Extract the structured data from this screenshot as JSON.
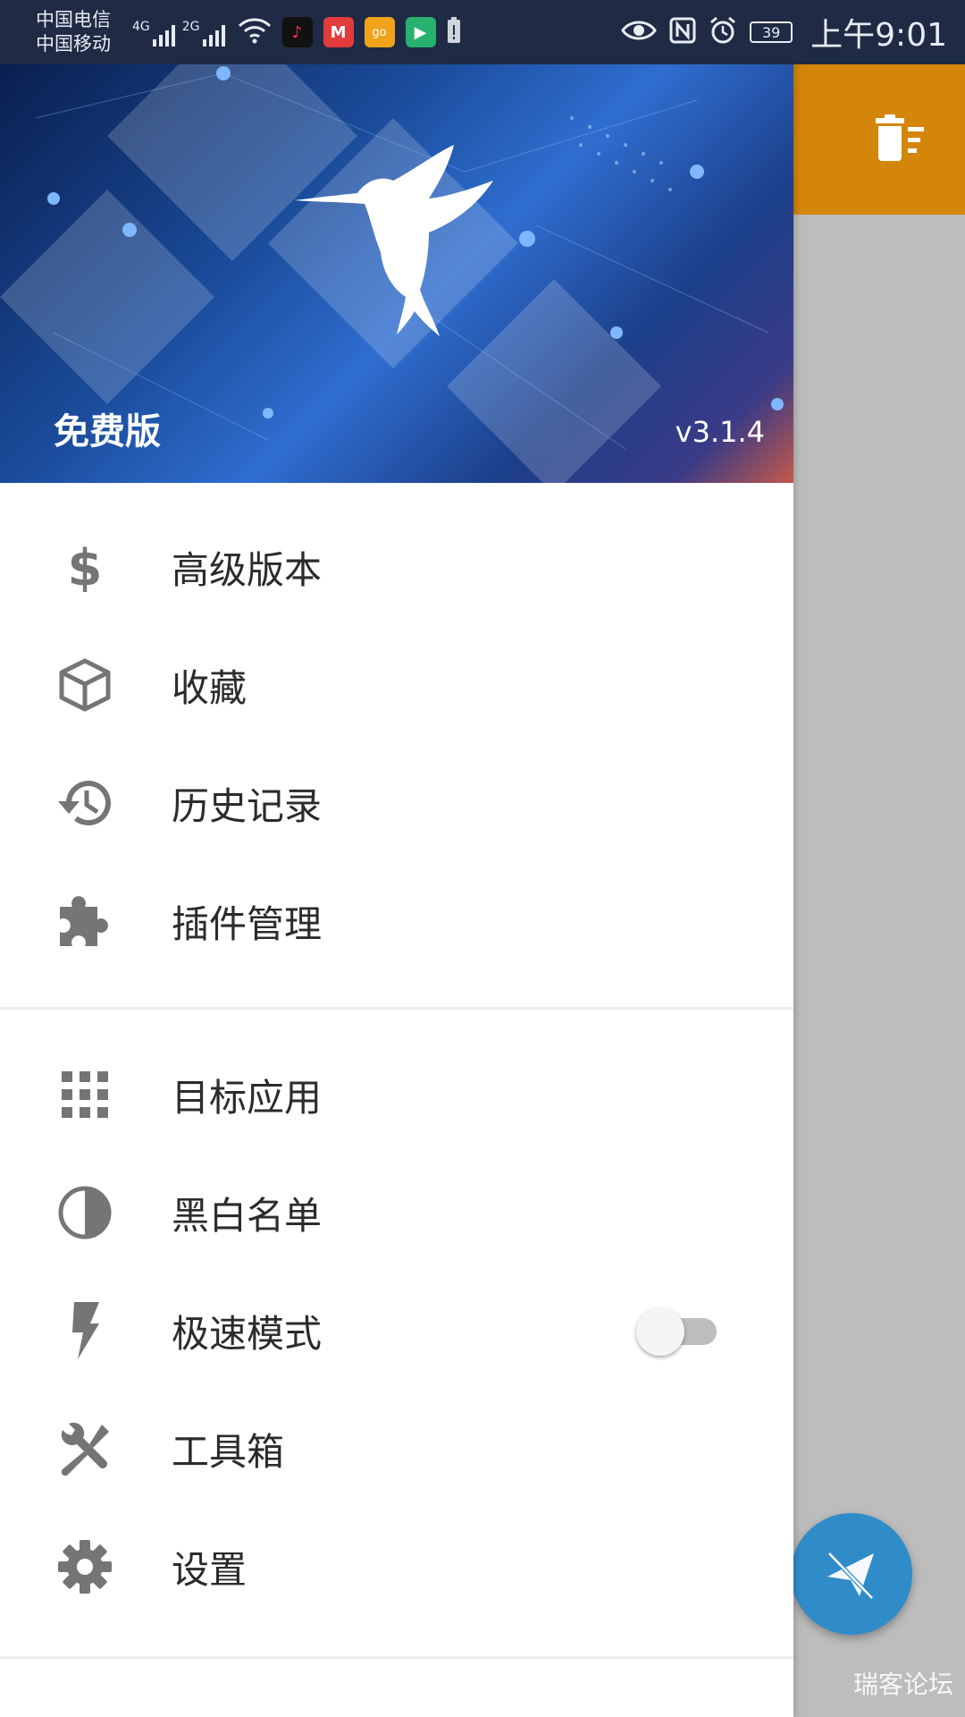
{
  "status_bar": {
    "carrier1": "中国电信",
    "carrier2": "中国移动",
    "net1": "4G",
    "net2": "2G",
    "battery": "39",
    "time": "上午9:01"
  },
  "header": {
    "edition": "免费版",
    "version": "v3.1.4"
  },
  "menu_group1": [
    {
      "label": "高级版本",
      "icon": "dollar-icon"
    },
    {
      "label": "收藏",
      "icon": "cube-icon"
    },
    {
      "label": "历史记录",
      "icon": "history-icon"
    },
    {
      "label": "插件管理",
      "icon": "puzzle-icon"
    }
  ],
  "menu_group2": [
    {
      "label": "目标应用",
      "icon": "apps-grid-icon"
    },
    {
      "label": "黑白名单",
      "icon": "half-circle-icon"
    },
    {
      "label": "极速模式",
      "icon": "flash-icon",
      "toggle": false
    },
    {
      "label": "工具箱",
      "icon": "tools-icon"
    },
    {
      "label": "设置",
      "icon": "gear-icon"
    }
  ],
  "watermark": "瑞客论坛",
  "colors": {
    "toolbar": "#d4860a",
    "fab": "#2f8cc9",
    "icon": "#757575"
  }
}
